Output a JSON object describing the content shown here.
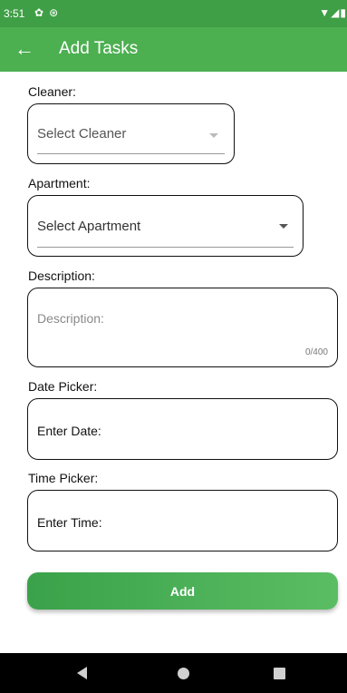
{
  "status_bar": {
    "time": "3:51",
    "left_icons": [
      "gear-icon",
      "at-icon"
    ],
    "right_icons": [
      "wifi-icon",
      "signal-icon",
      "battery-icon"
    ]
  },
  "app_bar": {
    "title": "Add Tasks",
    "back_icon": "arrow-back-icon",
    "background": "#4caf50"
  },
  "form": {
    "cleaner": {
      "label": "Cleaner:",
      "placeholder": "Select Cleaner"
    },
    "apartment": {
      "label": "Apartment:",
      "placeholder": "Select Apartment"
    },
    "description": {
      "label": "Description:",
      "placeholder": "Description:",
      "counter": "0/400"
    },
    "date": {
      "label": "Date Picker:",
      "value": "Enter Date:"
    },
    "time": {
      "label": "Time Picker:",
      "value": "Enter Time:"
    },
    "submit_label": "Add"
  },
  "nav_bar": {
    "icons": [
      "back-triangle-icon",
      "home-circle-icon",
      "recents-square-icon"
    ]
  }
}
